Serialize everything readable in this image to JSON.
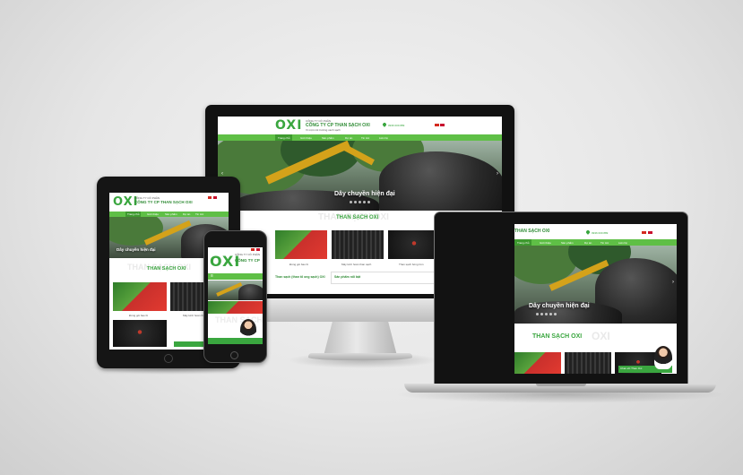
{
  "desktop": {
    "company_small": "CÔNG TY CỔ PHẦN",
    "company_name": "CÔNG TY CP THAN SẠCH OXI",
    "slogan": "Vì một môi trường xanh sạch",
    "hotline": "0936 009 889",
    "nav": [
      "Trang chủ",
      "Giới thiệu",
      "Sản phẩm",
      "Dự án",
      "Tin tức",
      "Liên hệ"
    ],
    "hero_caption": "Dây chuyền hiện đại",
    "section_title": "THAN SẠCH OXI",
    "product_captions": [
      "Đóng gói bao bì",
      "Máy kinh hoán than sạch",
      "Than sạch bóng tròn"
    ],
    "left_heading": "Than sạch (than tổ ong sạch) OXI",
    "right_heading": "Sản phẩm nổi bật"
  },
  "logo": "OXI",
  "tablet": {
    "company_small": "CÔNG TY CỔ PHẦN",
    "company_name": "CÔNG TY CP THAN SẠCH OXI",
    "hero_caption": "Dây chuyền hiện đại",
    "section_title": "THAN SẠCH OXI",
    "product_captions": [
      "Đóng gói bao bì",
      "Máy kinh hoán than sạch"
    ]
  },
  "phone": {
    "company_small": "CÔNG TY CỔ PHẦN",
    "company_name": "CÔNG TY CP",
    "ghost_text": "THAN SẠCH"
  },
  "laptop": {
    "company_name": "THAN SẠCH OXI",
    "nav": [
      "Trang chủ",
      "Giới thiệu",
      "Sản phẩm",
      "Dự án",
      "Tin tức",
      "Liên hệ"
    ],
    "hero_caption": "Dây chuyền hiện đại",
    "section_title": "THAN SẠCH OXI",
    "ghost_text": "OXI",
    "chat_label": "Chat với Than Oxi"
  },
  "colors": {
    "brand_green": "#3aa63f",
    "nav_green": "#5fbf46",
    "accent_red": "#c9302c"
  }
}
